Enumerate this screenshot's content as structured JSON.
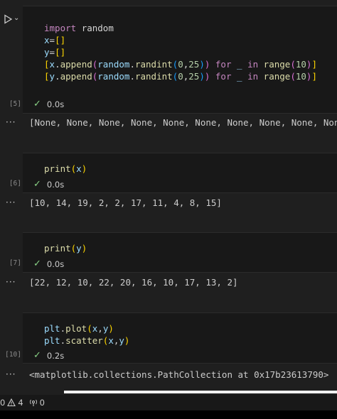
{
  "cells": [
    {
      "exec_count": "[5]",
      "code_lines": [
        "import random",
        "x=[]",
        "y=[]",
        "[x.append(random.randint(0,25)) for _ in range(10)]",
        "[y.append(random.randint(0,25)) for _ in range(10)]"
      ],
      "status_time": "0.0s",
      "output": "[None, None, None, None, None, None, None, None, None, None]"
    },
    {
      "exec_count": "[6]",
      "code_lines": [
        "print(x)"
      ],
      "status_time": "0.0s",
      "output": "[10, 14, 19, 2, 2, 17, 11, 4, 8, 15]"
    },
    {
      "exec_count": "[7]",
      "code_lines": [
        "print(y)"
      ],
      "status_time": "0.0s",
      "output": "[22, 12, 10, 22, 20, 16, 10, 17, 13, 2]"
    },
    {
      "exec_count": "[10]",
      "code_lines": [
        "plt.plot(x,y)",
        "plt.scatter(x,y)"
      ],
      "status_time": "0.2s",
      "output": "<matplotlib.collections.PathCollection at 0x17b23613790>"
    }
  ],
  "output_ellipsis": "···",
  "status_bar": {
    "errors": "0",
    "warnings": "4",
    "ports": "0"
  },
  "colors": {
    "background": "#1f1f1f",
    "cell_background": "#181818",
    "success": "#89d185",
    "keyword": "#c586c0",
    "variable": "#9cdcfe",
    "function": "#dcdcaa",
    "number": "#b5cea8"
  },
  "icons": [
    "run-icon",
    "chevron-down-icon",
    "check-icon",
    "error-icon",
    "warning-icon",
    "ports-icon"
  ]
}
